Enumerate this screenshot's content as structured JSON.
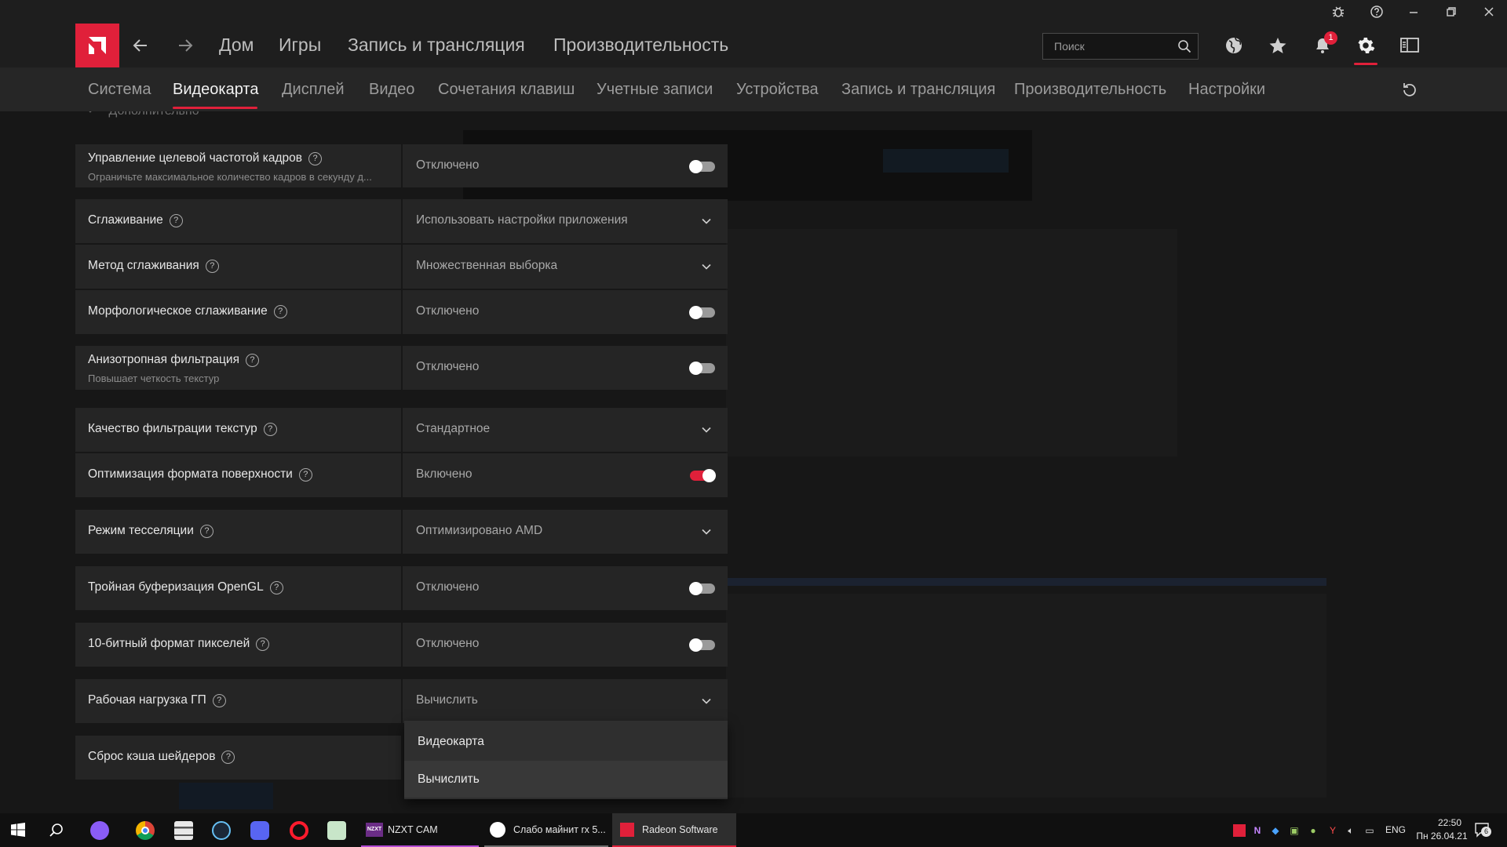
{
  "app": {
    "accent": "#e0203a"
  },
  "nav": {
    "items": [
      "Дом",
      "Игры",
      "Запись и трансляция",
      "Производительность"
    ],
    "search_placeholder": "Поиск",
    "notification_count": "1"
  },
  "subnav": {
    "tabs": [
      "Система",
      "Видеокарта",
      "Дисплей",
      "Видео",
      "Сочетания клавиш",
      "Учетные записи",
      "Устройства",
      "Запись и трансляция",
      "Производительность",
      "Настройки"
    ],
    "active": "Видеокарта"
  },
  "section": {
    "title": "Дополнительно"
  },
  "settings": [
    {
      "label": "Управление целевой частотой кадров",
      "sublabel": "Ограничьте максимальное количество кадров в секунду д...",
      "value": "Отключено",
      "control": "toggle",
      "on": false
    },
    {
      "label": "Сглаживание",
      "sublabel": "",
      "value": "Использовать настройки приложения",
      "control": "dropdown",
      "on": false
    },
    {
      "label": "Метод сглаживания",
      "sublabel": "",
      "value": "Множественная выборка",
      "control": "dropdown",
      "on": false
    },
    {
      "label": "Морфологическое сглаживание",
      "sublabel": "",
      "value": "Отключено",
      "control": "toggle",
      "on": false
    },
    {
      "label": "Анизотропная фильтрация",
      "sublabel": "Повышает четкость текстур",
      "value": "Отключено",
      "control": "toggle",
      "on": false
    },
    {
      "label": "Качество фильтрации текстур",
      "sublabel": "",
      "value": "Стандартное",
      "control": "dropdown",
      "on": false
    },
    {
      "label": "Оптимизация формата поверхности",
      "sublabel": "",
      "value": "Включено",
      "control": "toggle",
      "on": true
    },
    {
      "label": "Режим тесселяции",
      "sublabel": "",
      "value": "Оптимизировано AMD",
      "control": "dropdown",
      "on": false
    },
    {
      "label": "Тройная буферизация OpenGL",
      "sublabel": "",
      "value": "Отключено",
      "control": "toggle",
      "on": false
    },
    {
      "label": "10-битный формат пикселей",
      "sublabel": "",
      "value": "Отключено",
      "control": "toggle",
      "on": false
    },
    {
      "label": "Рабочая нагрузка ГП",
      "sublabel": "",
      "value": "Вычислить",
      "control": "dropdown",
      "on": false
    },
    {
      "label": "Сброс кэша шейдеров",
      "sublabel": "",
      "value": "",
      "control": "none",
      "on": false
    }
  ],
  "dropdown_options": [
    "Видеокарта",
    "Вычислить"
  ],
  "dropdown_selected": "Вычислить",
  "taskbar": {
    "apps": [
      "NZXT CAM",
      "Слабо майнит rx 5...",
      "Radeon Software"
    ],
    "nzxt_badge": "NZXT",
    "lang": "ENG",
    "time": "22:50",
    "date": "Пн 26.04.21",
    "action_center_count": "6"
  }
}
